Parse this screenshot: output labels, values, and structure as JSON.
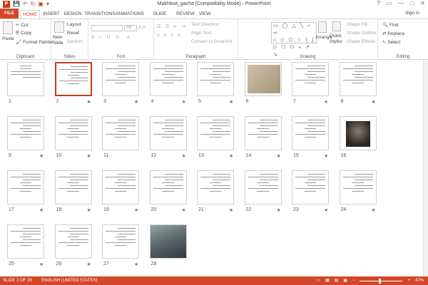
{
  "window": {
    "title": "Makhloot_gacha [Compatibility Mode] - PowerPoint",
    "controls": [
      "?",
      "▭",
      "—",
      "□",
      "✕"
    ]
  },
  "tabs": [
    "FILE",
    "HOME",
    "INSERT",
    "DESIGN",
    "TRANSITIONS",
    "ANIMATIONS",
    "SLIDE SHOW",
    "REVIEW",
    "VIEW"
  ],
  "signin": "Sign in",
  "ribbon": {
    "clipboard": {
      "paste": "Paste",
      "cut": "Cut",
      "copy": "Copy",
      "format_painter": "Format Painter",
      "label": "Clipboard"
    },
    "slides": {
      "new_slide": "New Slide",
      "layout": "Layout",
      "reset": "Reset",
      "section": "Section",
      "label": "Slides"
    },
    "font": {
      "size": "24",
      "label": "Font"
    },
    "paragraph": {
      "text_direction": "Text Direction",
      "align_text": "Align Text",
      "convert_smartart": "Convert to SmartArt",
      "label": "Paragraph"
    },
    "drawing": {
      "arrange": "Arrange",
      "quick_styles": "Quick Styles",
      "shape_fill": "Shape Fill",
      "shape_outline": "Shape Outline",
      "shape_effects": "Shape Effects",
      "label": "Drawing"
    },
    "editing": {
      "find": "Find",
      "replace": "Replace",
      "select": "Select",
      "label": "Editing"
    }
  },
  "slides": {
    "selected": 2,
    "items": [
      {
        "n": "1",
        "star": ""
      },
      {
        "n": "2",
        "star": "★"
      },
      {
        "n": "3",
        "star": "★"
      },
      {
        "n": "4",
        "star": "★"
      },
      {
        "n": "5",
        "star": "★"
      },
      {
        "n": "6",
        "star": ""
      },
      {
        "n": "7",
        "star": "★"
      },
      {
        "n": "8",
        "star": "★"
      },
      {
        "n": "9",
        "star": "★"
      },
      {
        "n": "10",
        "star": "★"
      },
      {
        "n": "11",
        "star": ""
      },
      {
        "n": "12",
        "star": "★"
      },
      {
        "n": "13",
        "star": "★"
      },
      {
        "n": "14",
        "star": "★"
      },
      {
        "n": "15",
        "star": "★"
      },
      {
        "n": "16",
        "star": ""
      },
      {
        "n": "17",
        "star": "★"
      },
      {
        "n": "18",
        "star": "★"
      },
      {
        "n": "19",
        "star": "★"
      },
      {
        "n": "20",
        "star": "★"
      },
      {
        "n": "21",
        "star": "★"
      },
      {
        "n": "22",
        "star": "★"
      },
      {
        "n": "23",
        "star": "★"
      },
      {
        "n": "24",
        "star": "★"
      },
      {
        "n": "25",
        "star": "★"
      },
      {
        "n": "26",
        "star": "★"
      },
      {
        "n": "27",
        "star": "★"
      },
      {
        "n": "28",
        "star": ""
      }
    ]
  },
  "status": {
    "slide_info": "SLIDE 2 OF 28",
    "language": "ENGLISH (UNITED STATES)",
    "zoom": "47%",
    "zoom_level": 0.47
  },
  "colors": {
    "accent": "#d24726"
  }
}
